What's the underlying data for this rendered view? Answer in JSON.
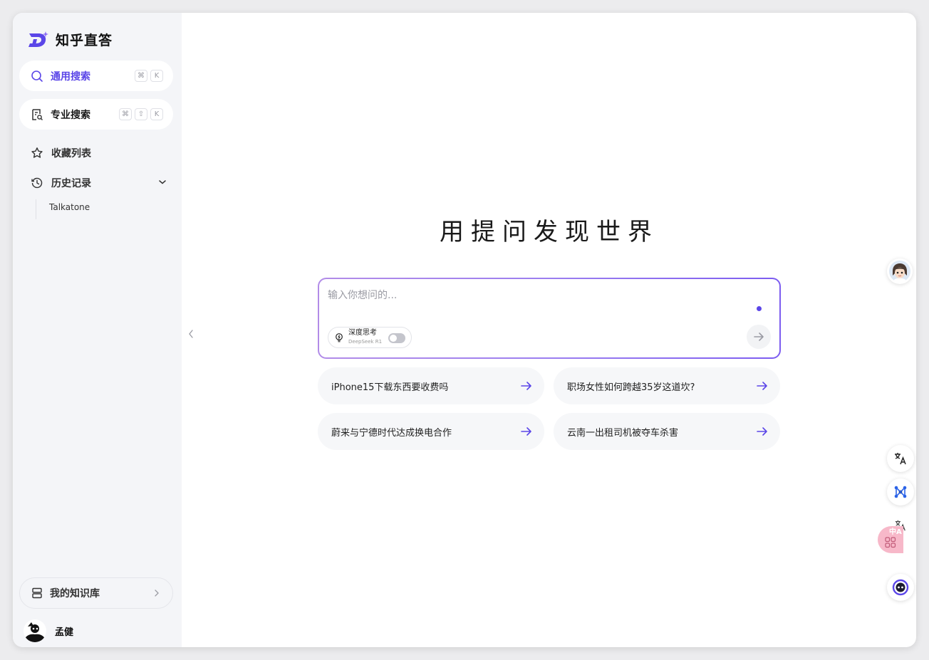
{
  "brand": {
    "title": "知乎直答",
    "logo_icon": "zhida-logo-icon",
    "accent": "#5b46e8"
  },
  "sidebar": {
    "general_search": {
      "label": "通用搜索",
      "keys": [
        "⌘",
        "K"
      ]
    },
    "pro_search": {
      "label": "专业搜索",
      "keys": [
        "⌘",
        "⇧",
        "K"
      ]
    },
    "favorites": {
      "label": "收藏列表"
    },
    "history": {
      "label": "历史记录",
      "items": [
        "Talkatone"
      ]
    },
    "knowledge_base": {
      "label": "我的知识库"
    },
    "user": {
      "name": "孟健"
    }
  },
  "main": {
    "title": "用提问发现世界",
    "input": {
      "placeholder": "输入你想问的...",
      "value": ""
    },
    "deep_think": {
      "label": "深度思考",
      "sublabel": "DeepSeek R1",
      "enabled": false
    },
    "suggestions": [
      "iPhone15下载东西要收费吗",
      "职场女性如何跨越35岁这道坎?",
      "蔚来与宁德时代达成换电合作",
      "云南一出租司机被夺车杀害"
    ]
  },
  "right_rail": {
    "pink_badge": "中A"
  }
}
